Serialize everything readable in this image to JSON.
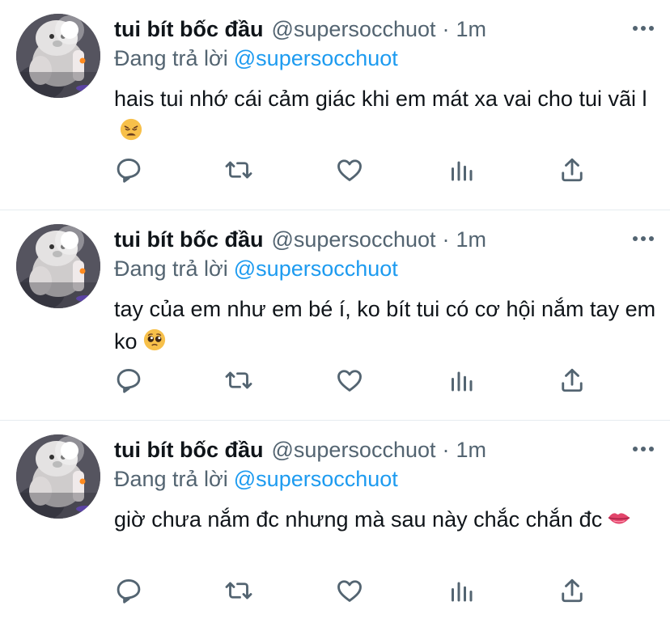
{
  "tweets": [
    {
      "display_name": "tui bít bốc đầu",
      "handle": "@supersocchuot",
      "separator": "·",
      "time": "1m",
      "replying_prefix": "Đang trả lời",
      "replying_to": "@supersocchuot",
      "text": "hais tui nhớ cái cảm giác khi em mát xa vai cho tui vãi l",
      "emoji": "weary-face"
    },
    {
      "display_name": "tui bít bốc đầu",
      "handle": "@supersocchuot",
      "separator": "·",
      "time": "1m",
      "replying_prefix": "Đang trả lời",
      "replying_to": "@supersocchuot",
      "text": "tay của em như em bé í, ko bít tui có cơ hội nắm tay em ko",
      "emoji": "pleading-face"
    },
    {
      "display_name": "tui bít bốc đầu",
      "handle": "@supersocchuot",
      "separator": "·",
      "time": "1m",
      "replying_prefix": "Đang trả lời",
      "replying_to": "@supersocchuot",
      "text": "giờ chưa nắm đc nhưng mà sau này chắc chắn đc",
      "emoji": "lips"
    }
  ],
  "icons": {
    "more": "more-horizontal-icon",
    "reply": "reply-icon",
    "retweet": "retweet-icon",
    "like": "heart-icon",
    "analytics": "analytics-icon",
    "share": "share-icon"
  },
  "colors": {
    "text": "#0f1419",
    "secondary": "#536471",
    "link": "#1d9bf0",
    "divider": "#e6ecf0"
  }
}
